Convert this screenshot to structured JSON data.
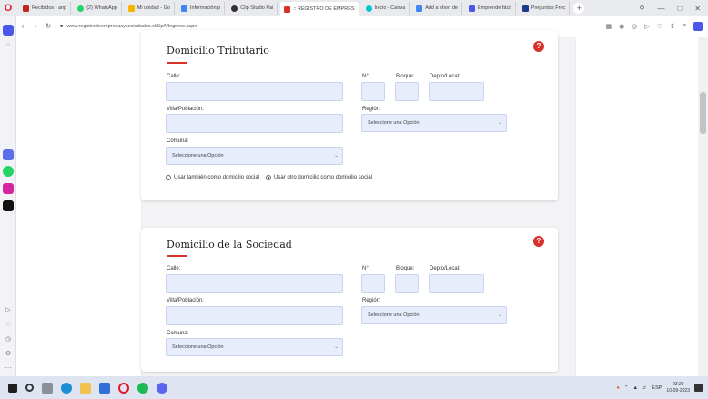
{
  "browser": {
    "logo": "O",
    "tabs": [
      {
        "label": "Recibidos - anp",
        "color": "#c5221f"
      },
      {
        "label": "(2) WhatsApp",
        "color": "#25d366"
      },
      {
        "label": "Mi unidad - Go",
        "color": "#f4b400"
      },
      {
        "label": "Información p",
        "color": "#4285f4"
      },
      {
        "label": "Clip Studio Pai",
        "color": "#333333"
      },
      {
        "label": ":: REGISTRO DE EMPRES",
        "color": "#d9302a",
        "active": true
      },
      {
        "label": "Inicio - Canva",
        "color": "#00c4cc"
      },
      {
        "label": "Add a short de",
        "color": "#4285f4"
      },
      {
        "label": "Emprende fácil",
        "color": "#4b57e8"
      },
      {
        "label": "Preguntas Frec",
        "color": "#1e3a8a"
      }
    ],
    "new_tab": "+",
    "url": "www.registrodeempresasysociedades.cl/SpA/Ingreso.aspx"
  },
  "sections": [
    {
      "title": "Domicilio Tributario",
      "labels": {
        "calle": "Calle:",
        "numero": "N°:",
        "bloque": "Bloque:",
        "depto": "Depto/Local:",
        "villa": "Villa/Población:",
        "region": "Región:",
        "comuna": "Comuna:"
      },
      "region_placeholder": "Seleccione una Opción",
      "comuna_placeholder": "Seleccione una Opción",
      "radio_options": [
        "Usar también como domicilio social",
        "Usar otro domicilio como domicilio social"
      ],
      "radio_selected_index": 1
    },
    {
      "title": "Domicilio de la Sociedad",
      "labels": {
        "calle": "Calle:",
        "numero": "N°:",
        "bloque": "Bloque:",
        "depto": "Depto/Local:",
        "villa": "Villa/Población:",
        "region": "Región:",
        "comuna": "Comuna:"
      },
      "region_placeholder": "Seleccione una Opción",
      "comuna_placeholder": "Seleccione una Opción"
    }
  ],
  "help_label": "?",
  "taskbar": {
    "lang": "ESP",
    "time": "23:20",
    "date": "10-09-2023"
  },
  "colors": {
    "accent": "#d9302a",
    "input_bg": "#e8edfb"
  }
}
